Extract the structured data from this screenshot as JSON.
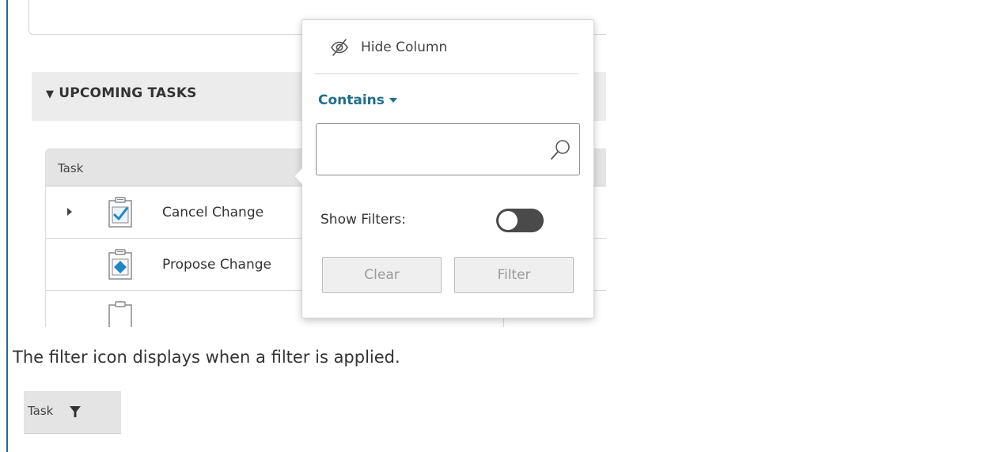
{
  "section": {
    "arrow": "▼",
    "title": "UPCOMING TASKS"
  },
  "grid": {
    "column_header": "Task",
    "rows": [
      {
        "name": "Cancel Change",
        "icon": "clipboard-check-icon",
        "expandable": true
      },
      {
        "name": "Propose Change",
        "icon": "clipboard-diamond-icon",
        "expandable": false
      }
    ]
  },
  "popup": {
    "hide_column_label": "Hide Column",
    "operator_label": "Contains",
    "search_value": "",
    "search_placeholder": "",
    "show_filters_label": "Show Filters:",
    "show_filters_on": false,
    "clear_label": "Clear",
    "filter_label": "Filter"
  },
  "caption": "The filter icon displays when a filter is applied.",
  "filtered_header": {
    "column_header": "Task",
    "icon": "filter-funnel-icon"
  },
  "colors": {
    "accent": "#1f6f8b",
    "header_bg": "#e4e4e4",
    "section_bg": "#ececec",
    "toggle_off": "#4a4a4a",
    "icon_blue": "#1f86c5"
  }
}
